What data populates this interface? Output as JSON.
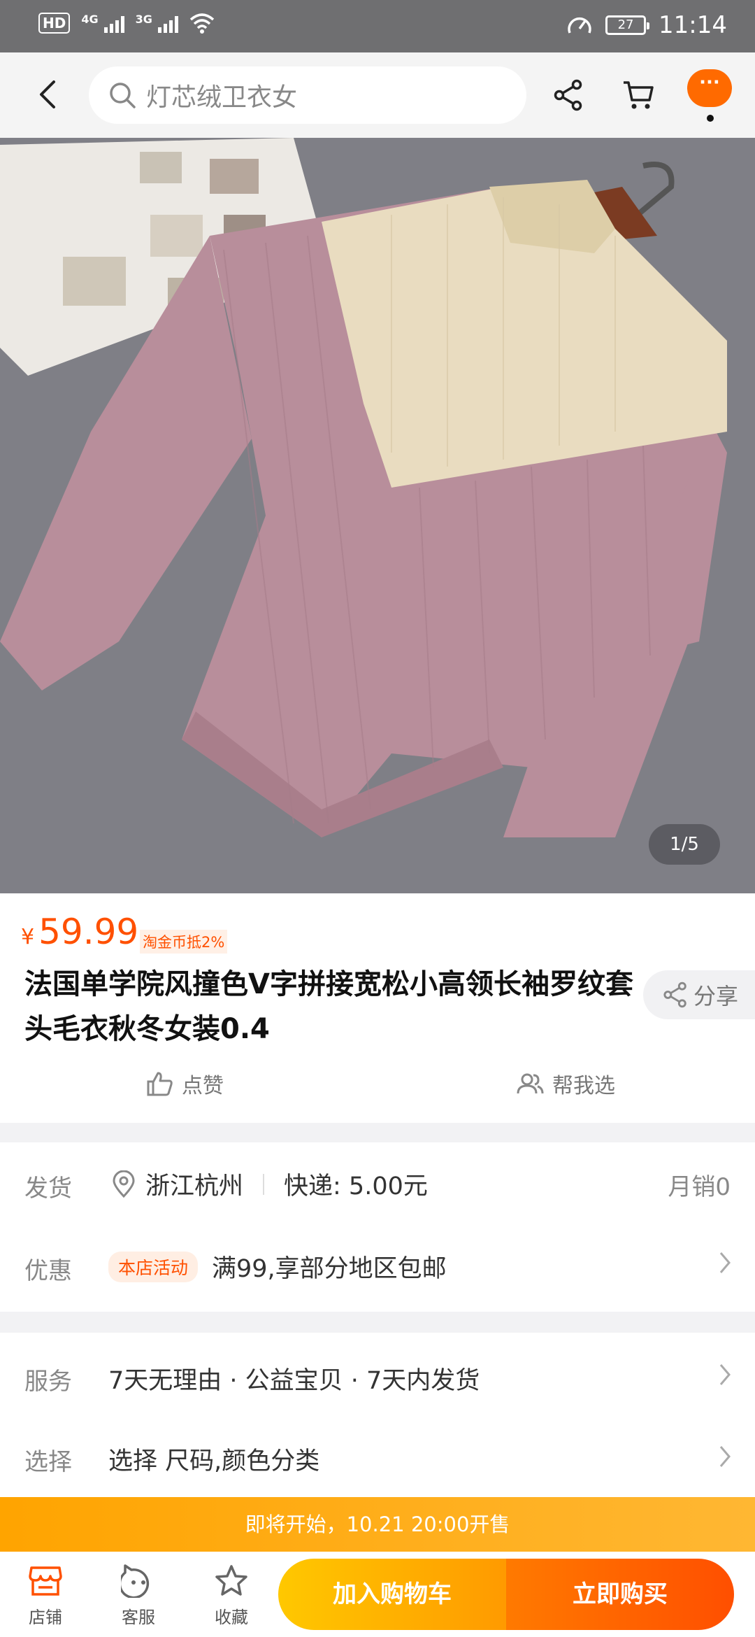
{
  "status_bar": {
    "hd": "HD",
    "sim1": "1",
    "net1": "4G",
    "net2": "3G",
    "battery": "27",
    "time": "11:14"
  },
  "header": {
    "search_placeholder": "灯芯绒卫衣女",
    "more_label": "···"
  },
  "gallery": {
    "counter": "1/5",
    "image_description": "pink and cream knit V-block sweater on hanger",
    "colors": {
      "sweater_pink": "#b88e9b",
      "sweater_cream": "#e9dcc0",
      "background": "#7f7f86"
    }
  },
  "product": {
    "currency": "¥",
    "price": "59.99",
    "coin_tag": "淘金币抵2%",
    "title": "法国单学院风撞色V字拼接宽松小高领长袖罗纹套头毛衣秋冬女装0.4",
    "share_label": "分享",
    "like_label": "点赞",
    "help_choose_label": "帮我选"
  },
  "delivery": {
    "label": "发货",
    "location": "浙江杭州",
    "shipping": "快递: 5.00元",
    "monthly_sales": "月销0"
  },
  "promotion": {
    "label": "优惠",
    "tag": "本店活动",
    "text": "满99,享部分地区包邮"
  },
  "service": {
    "label": "服务",
    "text": "7天无理由 · 公益宝贝 · 7天内发货"
  },
  "options": {
    "label": "选择",
    "text": "选择 尺码,颜色分类"
  },
  "presale_banner": "即将开始，10.21 20:00开售",
  "bottom_bar": {
    "store": "店铺",
    "service": "客服",
    "favorite": "收藏",
    "add_to_cart": "加入购物车",
    "buy_now": "立即购买"
  },
  "colors": {
    "accent": "#ff5000",
    "presale": "#ffa400"
  }
}
